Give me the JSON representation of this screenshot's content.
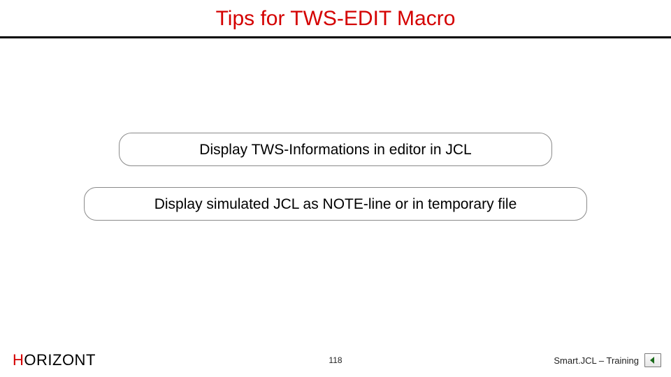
{
  "title": "Tips for TWS-EDIT Macro",
  "bullets": [
    "Display TWS-Informations in editor in JCL",
    "Display simulated JCL as NOTE-line or in temporary file"
  ],
  "footer": {
    "brand_accent_letter": "H",
    "brand_rest": "ORIZONT",
    "page_number": "118",
    "subtitle": "Smart.JCL – Training"
  },
  "colors": {
    "accent": "#d40000",
    "border": "#8a8a8a"
  }
}
